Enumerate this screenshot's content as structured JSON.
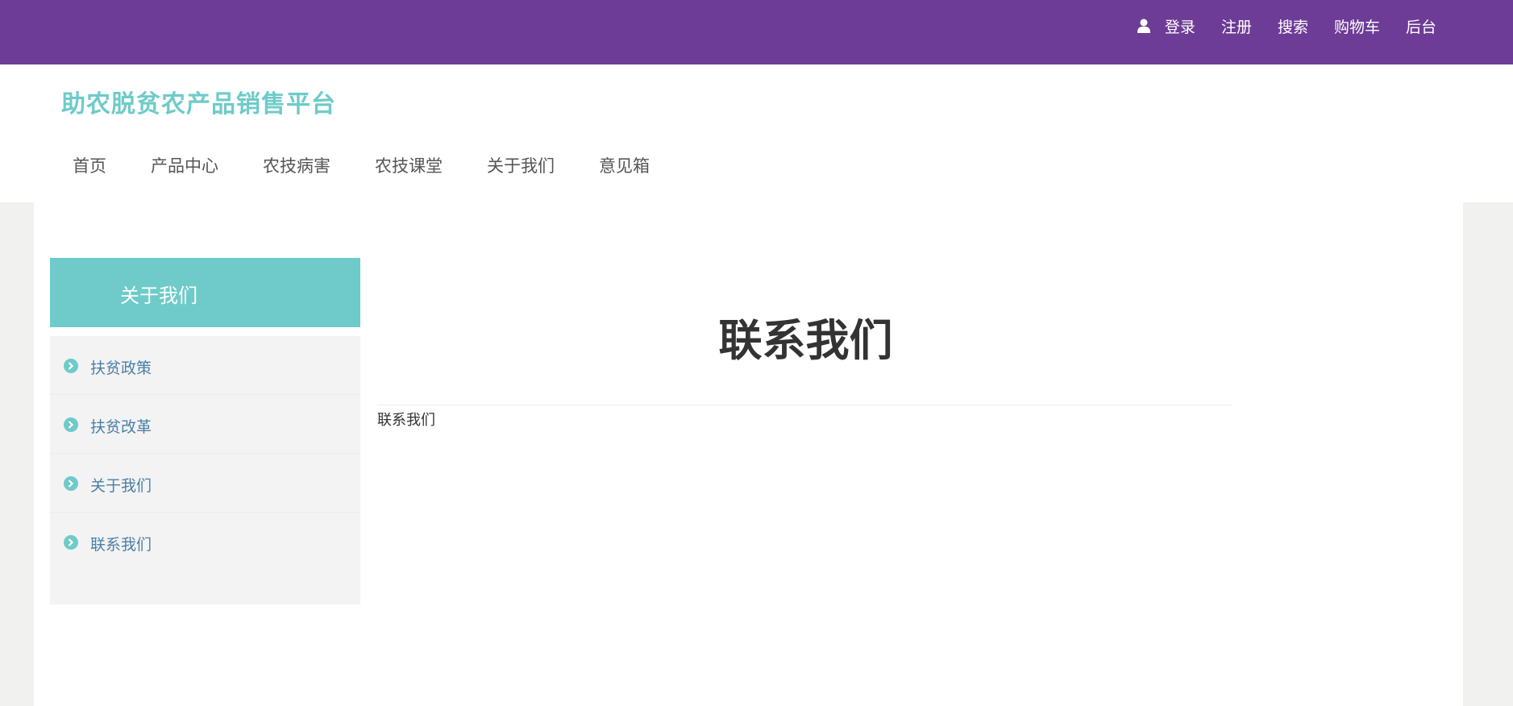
{
  "topbar": {
    "user_icon": "user-icon",
    "links": [
      "登录",
      "注册",
      "搜索",
      "购物车",
      "后台"
    ]
  },
  "header": {
    "brand": "助农脱贫农产品销售平台",
    "nav": [
      "首页",
      "产品中心",
      "农技病害",
      "农技课堂",
      "关于我们",
      "意见箱"
    ]
  },
  "sidebar": {
    "title": "关于我们",
    "items": [
      {
        "label": "扶贫政策",
        "icon": "chevron-right-circle-icon"
      },
      {
        "label": "扶贫改革",
        "icon": "chevron-right-circle-icon"
      },
      {
        "label": "关于我们",
        "icon": "chevron-right-circle-icon"
      },
      {
        "label": "联系我们",
        "icon": "chevron-right-circle-icon"
      }
    ]
  },
  "content": {
    "title": "联系我们",
    "body": "联系我们"
  },
  "colors": {
    "topbar": "#6d3c96",
    "accent": "#6ecbc9",
    "sidebar_link": "#4a7fa8"
  }
}
